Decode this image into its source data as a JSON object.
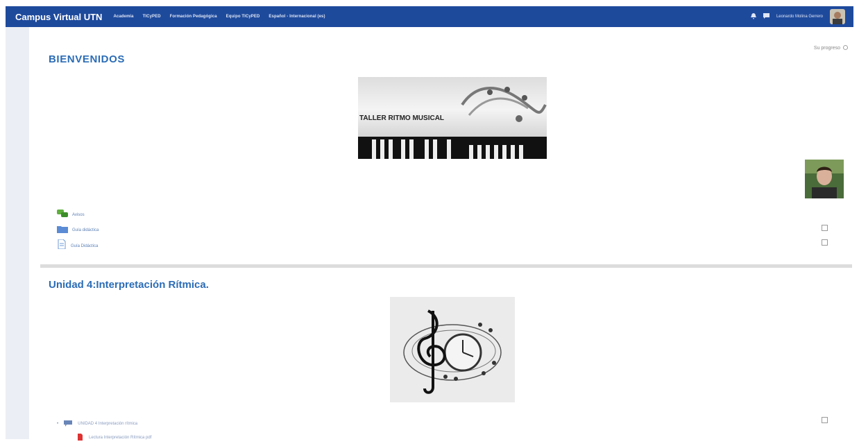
{
  "navbar": {
    "brand": "Campus Virtual UTN",
    "menu": [
      {
        "label": "Academia"
      },
      {
        "label": "TICyPED"
      },
      {
        "label": "Formación Pedagógica"
      },
      {
        "label": "Equipo TICyPED"
      },
      {
        "label": "Español - Internacional (es)"
      }
    ],
    "user_name": "Leonardo Molina Gerrero"
  },
  "progress_label": "Su progreso",
  "section_welcome": {
    "title": "BIENVENIDOS",
    "banner_text": "TALLER RITMO MUSICAL",
    "activities": [
      {
        "label": "Avisos",
        "icon": "forum-icon"
      },
      {
        "label": "Guía didáctica",
        "icon": "folder-icon"
      },
      {
        "label": "Guía Didáctica",
        "icon": "file-icon"
      }
    ]
  },
  "section_unit4": {
    "title": "Unidad 4:Interpretación Rítmica.",
    "activities": [
      {
        "label": "UNIDAD 4 Interpretación rítmica",
        "icon": "chat-icon"
      },
      {
        "label": "Lectura Interpretación Rítmica pdf",
        "icon": "pdf-icon"
      }
    ]
  },
  "colors": {
    "navbar": "#1e4a9c",
    "title": "#2b6cb6",
    "link": "#5a7fb5"
  }
}
